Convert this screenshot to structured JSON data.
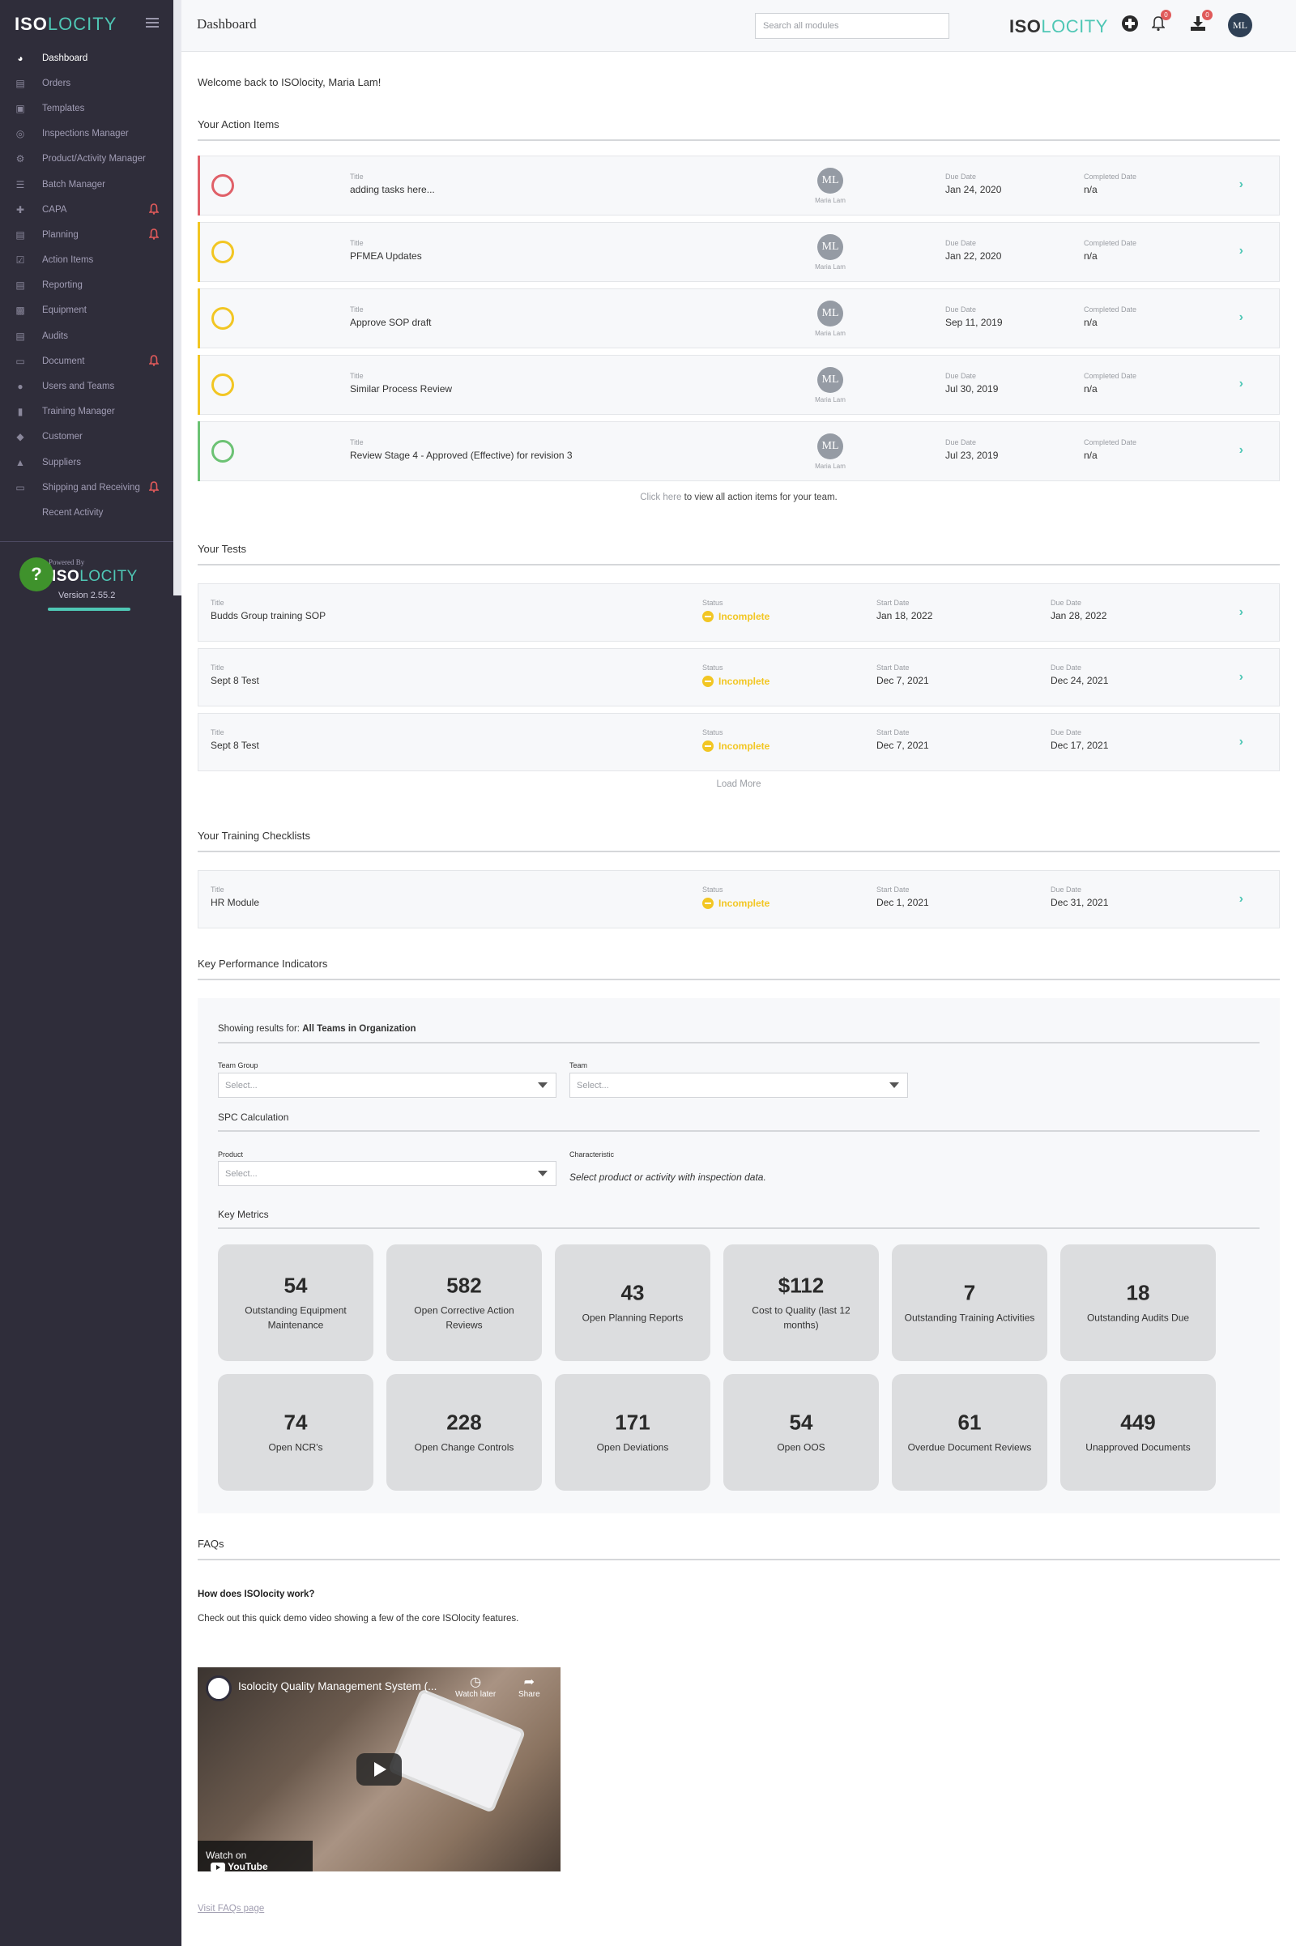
{
  "app": {
    "brand_iso": "ISO",
    "brand_loc": "LOCITY",
    "page_title": "Dashboard"
  },
  "sidebar": {
    "items": [
      {
        "label": "Dashboard",
        "icon": "dashboard-gauge-icon",
        "active": true,
        "alert": false
      },
      {
        "label": "Orders",
        "icon": "inbox-tray-icon",
        "active": false,
        "alert": false
      },
      {
        "label": "Templates",
        "icon": "image-icon",
        "active": false,
        "alert": false
      },
      {
        "label": "Inspections Manager",
        "icon": "target-icon",
        "active": false,
        "alert": false
      },
      {
        "label": "Product/Activity Manager",
        "icon": "gear-icon",
        "active": false,
        "alert": false
      },
      {
        "label": "Batch Manager",
        "icon": "barcode-icon",
        "active": false,
        "alert": false
      },
      {
        "label": "CAPA",
        "icon": "medkit-icon",
        "active": false,
        "alert": true
      },
      {
        "label": "Planning",
        "icon": "map-icon",
        "active": false,
        "alert": true
      },
      {
        "label": "Action Items",
        "icon": "checkbox-icon",
        "active": false,
        "alert": false
      },
      {
        "label": "Reporting",
        "icon": "report-icon",
        "active": false,
        "alert": false
      },
      {
        "label": "Equipment",
        "icon": "truck-icon",
        "active": false,
        "alert": false
      },
      {
        "label": "Audits",
        "icon": "file-text-icon",
        "active": false,
        "alert": false
      },
      {
        "label": "Document",
        "icon": "folder-icon",
        "active": false,
        "alert": true
      },
      {
        "label": "Users and Teams",
        "icon": "users-icon",
        "active": false,
        "alert": false
      },
      {
        "label": "Training Manager",
        "icon": "book-icon",
        "active": false,
        "alert": false
      },
      {
        "label": "Customer",
        "icon": "tag-icon",
        "active": false,
        "alert": false
      },
      {
        "label": "Suppliers",
        "icon": "ship-icon",
        "active": false,
        "alert": false
      },
      {
        "label": "Shipping and Receiving",
        "icon": "inbox-icon",
        "active": false,
        "alert": true
      },
      {
        "label": "Recent Activity",
        "icon": "",
        "active": false,
        "alert": false
      }
    ],
    "powered_by": "Powered By",
    "version": "Version 2.55.2",
    "help_label": "?"
  },
  "topbar": {
    "search_placeholder": "Search all modules",
    "notifications_count": "0",
    "downloads_count": "0",
    "avatar_initials": "ML"
  },
  "welcome": "Welcome back to ISOlocity, Maria Lam!",
  "action_items": {
    "heading": "Your Action Items",
    "labels": {
      "title": "Title",
      "due": "Due Date",
      "completed": "Completed Date"
    },
    "items": [
      {
        "status_color": "#e06068",
        "title": "adding tasks here...",
        "assignee_initials": "ML",
        "assignee": "Maria Lam",
        "due": "Jan 24, 2020",
        "completed": "n/a"
      },
      {
        "status_color": "#f2c623",
        "title": "PFMEA Updates",
        "assignee_initials": "ML",
        "assignee": "Maria Lam",
        "due": "Jan 22, 2020",
        "completed": "n/a"
      },
      {
        "status_color": "#f2c623",
        "title": "Approve SOP draft",
        "assignee_initials": "ML",
        "assignee": "Maria Lam",
        "due": "Sep 11, 2019",
        "completed": "n/a"
      },
      {
        "status_color": "#f2c623",
        "title": "Similar Process Review",
        "assignee_initials": "ML",
        "assignee": "Maria Lam",
        "due": "Jul 30, 2019",
        "completed": "n/a"
      },
      {
        "status_color": "#6cc274",
        "title": "Review Stage 4 - Approved (Effective) for revision 3",
        "assignee_initials": "ML",
        "assignee": "Maria Lam",
        "due": "Jul 23, 2019",
        "completed": "n/a"
      }
    ],
    "view_all_link": "Click here",
    "view_all_rest": " to view all action items for your team."
  },
  "tests": {
    "heading": "Your Tests",
    "labels": {
      "title": "Title",
      "status": "Status",
      "start": "Start Date",
      "due": "Due Date"
    },
    "items": [
      {
        "title": "Budds Group training SOP",
        "status": "Incomplete",
        "start": "Jan 18, 2022",
        "due": "Jan 28, 2022"
      },
      {
        "title": "Sept 8 Test",
        "status": "Incomplete",
        "start": "Dec 7, 2021",
        "due": "Dec 24, 2021"
      },
      {
        "title": "Sept 8 Test",
        "status": "Incomplete",
        "start": "Dec 7, 2021",
        "due": "Dec 17, 2021"
      }
    ],
    "load_more": "Load More"
  },
  "checklists": {
    "heading": "Your Training Checklists",
    "items": [
      {
        "title": "HR Module",
        "status": "Incomplete",
        "start": "Dec 1, 2021",
        "due": "Dec 31, 2021"
      }
    ]
  },
  "kpi": {
    "heading": "Key Performance Indicators",
    "showing_label": "Showing results for: ",
    "showing_value": "All Teams in Organization",
    "team_group_label": "Team Group",
    "team_label": "Team",
    "select_placeholder": "Select...",
    "spc_heading": "SPC Calculation",
    "product_label": "Product",
    "characteristic_label": "Characteristic",
    "characteristic_hint": "Select product or activity with inspection data.",
    "metrics_heading": "Key Metrics",
    "metrics": [
      {
        "value": "54",
        "label": "Outstanding Equipment Maintenance"
      },
      {
        "value": "582",
        "label": "Open Corrective Action Reviews"
      },
      {
        "value": "43",
        "label": "Open Planning Reports"
      },
      {
        "value": "$112",
        "label": "Cost to Quality (last 12 months)"
      },
      {
        "value": "7",
        "label": "Outstanding Training Activities"
      },
      {
        "value": "18",
        "label": "Outstanding Audits Due"
      },
      {
        "value": "74",
        "label": "Open NCR's"
      },
      {
        "value": "228",
        "label": "Open Change Controls"
      },
      {
        "value": "171",
        "label": "Open Deviations"
      },
      {
        "value": "54",
        "label": "Open OOS"
      },
      {
        "value": "61",
        "label": "Overdue Document Reviews"
      },
      {
        "value": "449",
        "label": "Unapproved Documents"
      }
    ]
  },
  "faqs": {
    "heading": "FAQs",
    "question": "How does ISOlocity work?",
    "answer": "Check out this quick demo video showing a few of the core ISOlocity features.",
    "video_title": "Isolocity Quality Management System (...",
    "watch_later": "Watch later",
    "share": "Share",
    "watch_on": "Watch on",
    "youtube": "YouTube",
    "faq_link": "Visit FAQs page"
  }
}
